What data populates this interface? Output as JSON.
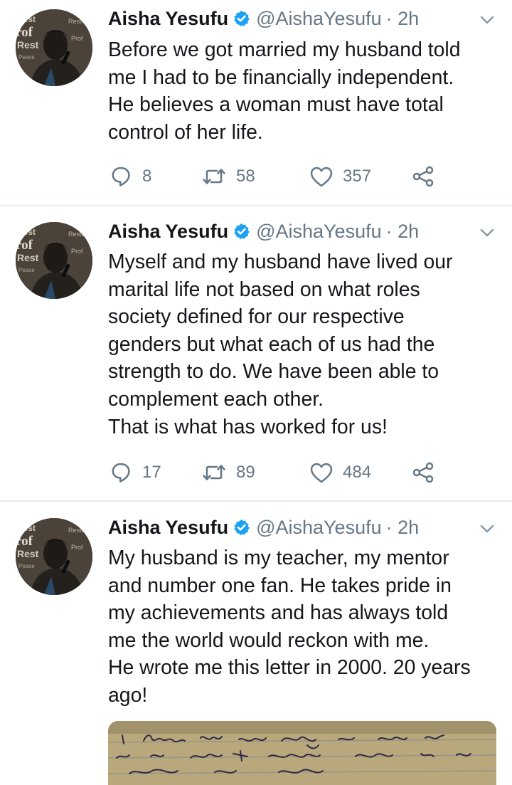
{
  "colors": {
    "text": "#14171a",
    "secondary": "#657786",
    "verified": "#1da1f2",
    "divider": "#e6ecf0"
  },
  "icons": {
    "reply": "reply-icon",
    "retweet": "retweet-icon",
    "like": "heart-icon",
    "share": "share-icon",
    "verified": "verified-badge-icon",
    "menu": "chevron-down-icon"
  },
  "tweets": [
    {
      "name": "Aisha Yesufu",
      "handle": "@AishaYesufu",
      "time": "· 2h",
      "text": "Before we got married my husband told\nme I had to be financially independent.\nHe believes a woman must have total\ncontrol  of her life.",
      "replies": "8",
      "retweets": "58",
      "likes": "357"
    },
    {
      "name": "Aisha Yesufu",
      "handle": "@AishaYesufu",
      "time": "· 2h",
      "text": "Myself and my husband have lived our\nmarital life not based on what roles\nsociety defined for our respective\ngenders but what each of us had the\nstrength to do. We have been able to\ncomplement each other.\nThat is what has worked for us!",
      "replies": "17",
      "retweets": "89",
      "likes": "484"
    },
    {
      "name": "Aisha Yesufu",
      "handle": "@AishaYesufu",
      "time": "· 2h",
      "text": "My husband is my teacher, my mentor\nand number one fan. He takes pride in\nmy achievements and has always told\nme the world would reckon with me.\nHe wrote me this letter in 2000. 20 years\nago!"
    }
  ]
}
